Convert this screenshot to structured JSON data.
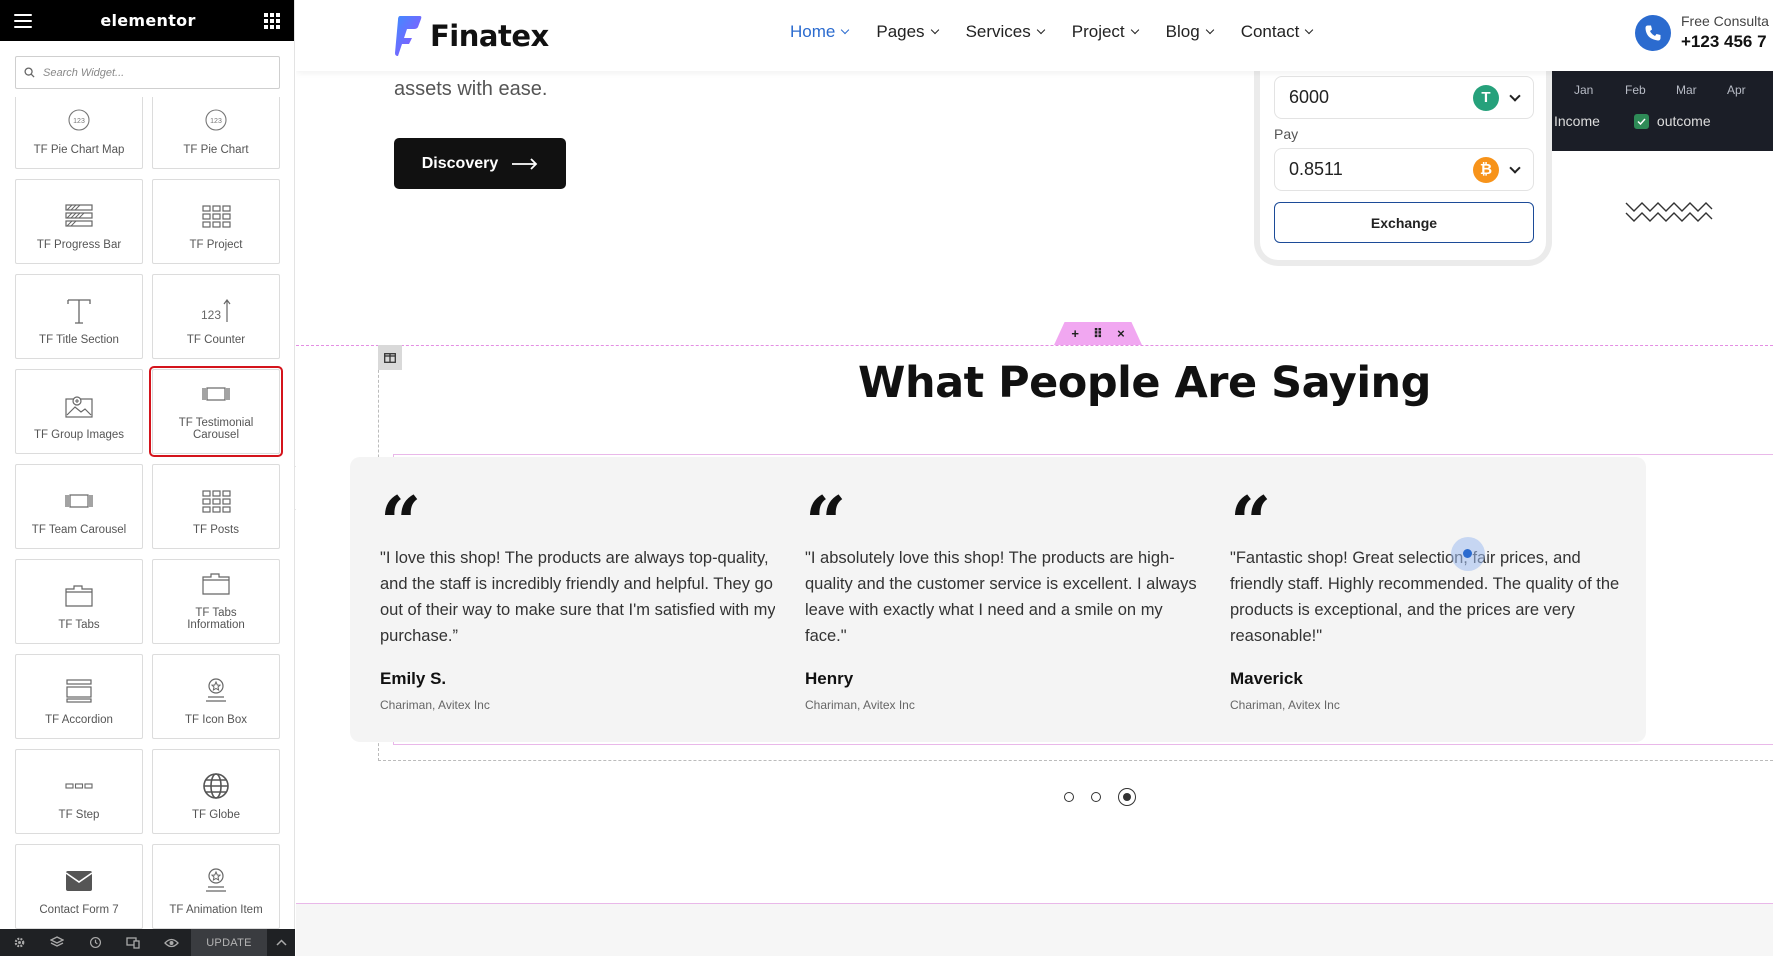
{
  "sidebar": {
    "title": "elementor",
    "search_placeholder": "Search Widget...",
    "widgets": [
      {
        "label": "TF Pie Chart Map",
        "icon": "pie-chart-123-icon"
      },
      {
        "label": "TF Pie Chart",
        "icon": "pie-chart-123-icon"
      },
      {
        "label": "TF Progress Bar",
        "icon": "progress-bar-icon"
      },
      {
        "label": "TF Project",
        "icon": "grid-icon"
      },
      {
        "label": "TF Title Section",
        "icon": "title-t-icon"
      },
      {
        "label": "TF Counter",
        "icon": "counter-icon"
      },
      {
        "label": "TF Group Images",
        "icon": "images-icon"
      },
      {
        "label": "TF Testimonial Carousel",
        "icon": "carousel-icon",
        "selected": true
      },
      {
        "label": "TF Team Carousel",
        "icon": "carousel-icon"
      },
      {
        "label": "TF Posts",
        "icon": "grid-icon"
      },
      {
        "label": "TF Tabs",
        "icon": "tabs-icon"
      },
      {
        "label": "TF Tabs Information",
        "icon": "tabs-icon"
      },
      {
        "label": "TF Accordion",
        "icon": "accordion-icon"
      },
      {
        "label": "TF Icon Box",
        "icon": "icon-box-icon"
      },
      {
        "label": "TF Step",
        "icon": "step-dots-icon"
      },
      {
        "label": "TF Globe",
        "icon": "globe-icon"
      },
      {
        "label": "Contact Form 7",
        "icon": "envelope-icon"
      },
      {
        "label": "TF Animation Item",
        "icon": "icon-box-icon"
      }
    ],
    "footer": {
      "update_label": "UPDATE"
    }
  },
  "site": {
    "brand": "Finatex",
    "nav": [
      {
        "label": "Home",
        "active": true
      },
      {
        "label": "Pages"
      },
      {
        "label": "Services"
      },
      {
        "label": "Project"
      },
      {
        "label": "Blog"
      },
      {
        "label": "Contact"
      }
    ],
    "consult": {
      "line1": "Free Consulta",
      "line2": "+123 456 7"
    },
    "hero_text": "assets with ease.",
    "discover_label": "Discovery",
    "exchange": {
      "receive_value": "6000",
      "pay_label": "Pay",
      "pay_value": "0.8511",
      "button_label": "Exchange"
    },
    "chart_panel": {
      "months": [
        "Jan",
        "Feb",
        "Mar",
        "Apr"
      ],
      "legend_income": "Income",
      "legend_outcome": "outcome"
    },
    "testimonials": {
      "title": "What People Are Saying",
      "items": [
        {
          "text": "\"I love this shop! The products are always top-quality, and the staff is incredibly friendly and helpful. They go out of their way to make sure that I'm satisfied with my purchase.”",
          "name": "Emily S.",
          "role": "Chariman, Avitex Inc"
        },
        {
          "text": "\"I absolutely love this shop! The products are high-quality and the customer service is excellent. I always leave with exactly what I need and a smile on my face.\"",
          "name": "Henry",
          "role": "Chariman, Avitex Inc"
        },
        {
          "text": "\"Fantastic shop! Great selection, fair prices, and friendly staff. Highly recommended. The quality of the products is exceptional, and the prices are very reasonable!\"",
          "name": "Maverick",
          "role": "Chariman, Avitex Inc"
        }
      ],
      "active_slide": 3,
      "slide_count": 3
    }
  },
  "colors": {
    "accent": "#2b6bcf",
    "selected_outline": "#d4141c",
    "tether": "#26a17b",
    "bitcoin": "#f7931a"
  }
}
